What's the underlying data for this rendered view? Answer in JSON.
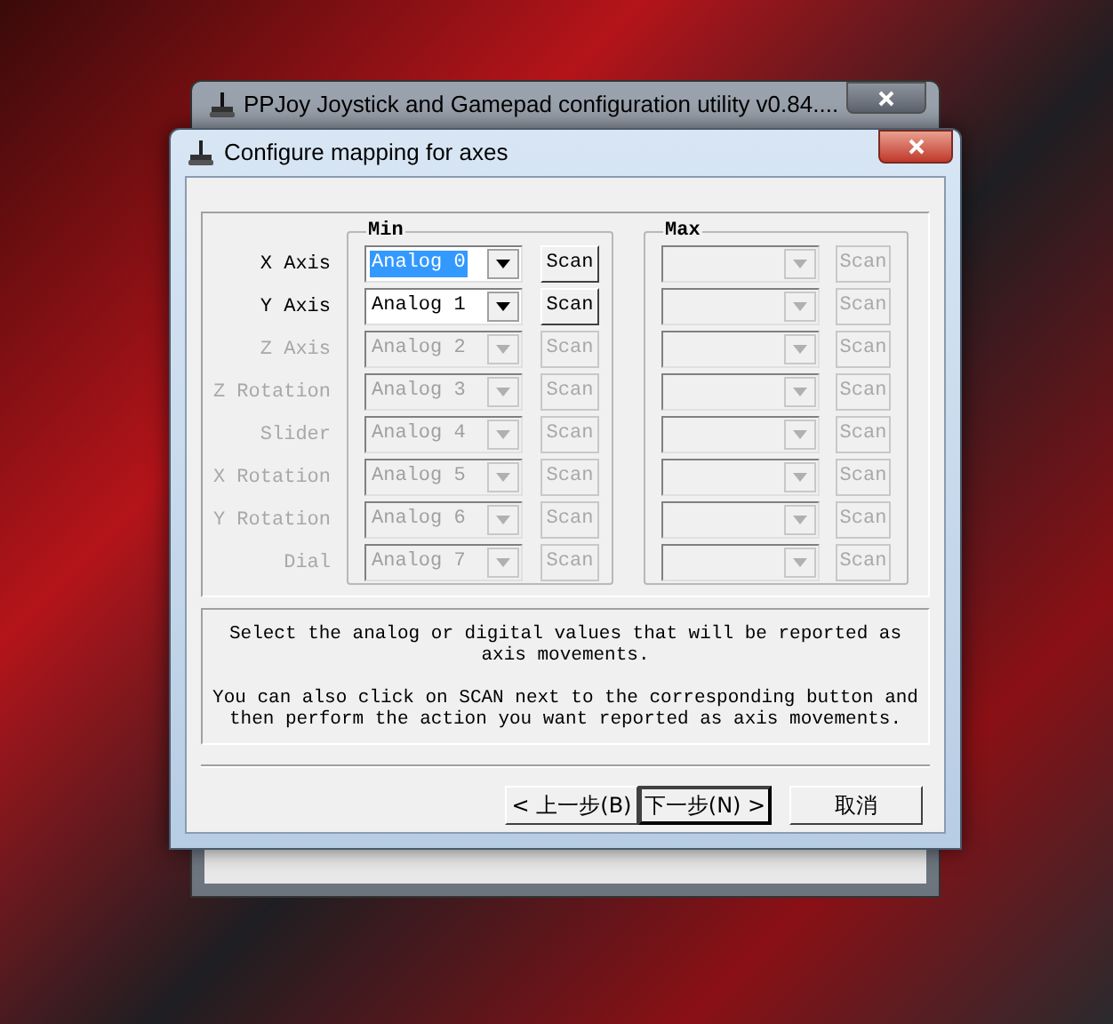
{
  "parent_window": {
    "title": "PPJoy Joystick and Gamepad configuration utility  v0.84...."
  },
  "dialog": {
    "title": "Configure mapping for axes"
  },
  "min_group": {
    "label": "Min"
  },
  "max_group": {
    "label": "Max"
  },
  "axes": [
    {
      "label": "X Axis",
      "disabled": false,
      "min_value": "Analog 0",
      "min_focused": true,
      "min_scan": "Scan",
      "max_scan": "Scan",
      "max_disabled": true
    },
    {
      "label": "Y Axis",
      "disabled": false,
      "min_value": "Analog 1",
      "min_focused": false,
      "min_scan": "Scan",
      "max_scan": "Scan",
      "max_disabled": true
    },
    {
      "label": "Z Axis",
      "disabled": true,
      "min_value": "Analog 2",
      "min_focused": false,
      "min_scan": "Scan",
      "max_scan": "Scan",
      "max_disabled": true
    },
    {
      "label": "Z Rotation",
      "disabled": true,
      "min_value": "Analog 3",
      "min_focused": false,
      "min_scan": "Scan",
      "max_scan": "Scan",
      "max_disabled": true
    },
    {
      "label": "Slider",
      "disabled": true,
      "min_value": "Analog 4",
      "min_focused": false,
      "min_scan": "Scan",
      "max_scan": "Scan",
      "max_disabled": true
    },
    {
      "label": "X Rotation",
      "disabled": true,
      "min_value": "Analog 5",
      "min_focused": false,
      "min_scan": "Scan",
      "max_scan": "Scan",
      "max_disabled": true
    },
    {
      "label": "Y Rotation",
      "disabled": true,
      "min_value": "Analog 6",
      "min_focused": false,
      "min_scan": "Scan",
      "max_scan": "Scan",
      "max_disabled": true
    },
    {
      "label": "Dial",
      "disabled": true,
      "min_value": "Analog 7",
      "min_focused": false,
      "min_scan": "Scan",
      "max_scan": "Scan",
      "max_disabled": true
    }
  ],
  "help_text": [
    "Select the analog or digital values that will be reported as axis movements.",
    "You can also click on SCAN next to the corresponding button and then perform the action you want reported as axis movements."
  ],
  "buttons": [
    {
      "label": "< 上一步(B)",
      "kind": "back",
      "default": false
    },
    {
      "label": "下一步(N) >",
      "kind": "next",
      "default": true
    },
    {
      "label": "取消",
      "kind": "cancel",
      "default": false
    }
  ]
}
